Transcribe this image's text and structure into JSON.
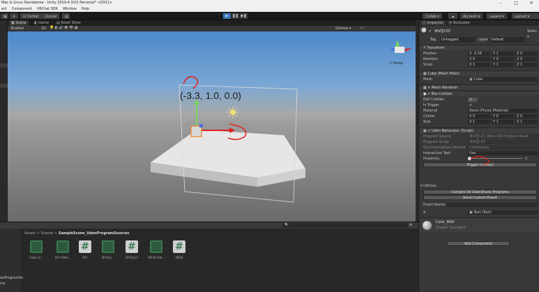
{
  "title": "Mac & Linux Standalone - Unity 2019.4.31f1 Personal* <DX11>",
  "window_controls": {
    "minimize": "–",
    "maximize": "□",
    "close": "✕"
  },
  "menu": [
    "ect",
    "Component",
    "VRChat SDK",
    "Window",
    "Help"
  ],
  "toolbar": {
    "center": "Center",
    "local": "Local",
    "collab": "Collab ▾",
    "account": "Account ▾",
    "layers": "Layers ▾",
    "layout": "Layout ▾"
  },
  "scene_tabs": {
    "scene": "Scene",
    "game": "Game",
    "asset_store": "Asset Store"
  },
  "scene_toolbar": {
    "shading": "Shaded",
    "mode": "2D",
    "gizmos": "Gizmos ▾",
    "search": "All"
  },
  "scene": {
    "coord_label": "(-3.3, 1.0, 0.0)",
    "persp": "< Persp"
  },
  "project": {
    "breadcrumb": [
      "Assets",
      "Scenes",
      "SampleScene_UdonProgramSources"
    ],
    "assets": [
      {
        "name": "Cube (U..."
      },
      {
        "name": "큐브 Udon..."
      },
      {
        "name": "큐브"
      },
      {
        "name": "큐브입니..."
      },
      {
        "name": "큐브입니다"
      },
      {
        "name": "버튼용 Udo..."
      },
      {
        "name": "버튼용"
      }
    ],
    "left_fragments": [
      "onProgramSc",
      "ms"
    ]
  },
  "inspector": {
    "tabs": {
      "inspector": "Inspector",
      "occlusion": "Occlusion"
    },
    "object_name": "큐브입니다",
    "static": "Static ▾",
    "tag_label": "Tag",
    "tag_value": "Untagged",
    "layer_label": "Layer",
    "layer_value": "Default",
    "transform": {
      "title": "Transform",
      "position": {
        "label": "Position",
        "x": "-3.34",
        "y": "1",
        "z": "0"
      },
      "rotation": {
        "label": "Rotation",
        "x": "0",
        "y": "0",
        "z": "0"
      },
      "scale": {
        "label": "Scale",
        "x": "1",
        "y": "1",
        "z": "1"
      }
    },
    "mesh_filter": {
      "title": "Cube (Mesh Filter)",
      "mesh_label": "Mesh",
      "mesh_value": "Cube"
    },
    "mesh_renderer": {
      "title": "Mesh Renderer"
    },
    "box_collider": {
      "title": "Box Collider",
      "edit_collider": "Edit Collider",
      "is_trigger": "Is Trigger",
      "material_label": "Material",
      "material_value": "None (Physic Material)",
      "center": {
        "label": "Center",
        "x": "0",
        "y": "0",
        "z": "0"
      },
      "size": {
        "label": "Size",
        "x": "1",
        "y": "1",
        "z": "1"
      }
    },
    "udon": {
      "title": "Udon Behaviour (Script)",
      "program_source_label": "Program Source",
      "program_source_value": "큐브입니다 Udon C# Program Asset",
      "program_script_label": "Program Script",
      "program_script_value": "큐브입니다",
      "sync_label": "Synchronization Method",
      "sync_value": "Continuous",
      "interaction_text_label": "Interaction Text",
      "interaction_text_value": "Use",
      "proximity_label": "Proximity",
      "proximity_value": "2",
      "proximity_fraction": 0.0,
      "trigger_button": "Trigger Interact"
    },
    "utilities": {
      "title": "Utilities",
      "compile_button": "Compile All UdonSharp Programs",
      "send_event_button": "Send Custom Event",
      "event_name_label": "Event Name:",
      "a_label": "A",
      "a_value": "Text (Text)"
    },
    "material": {
      "name": "Color_M00",
      "shader_label": "Shader",
      "shader_value": "Standard"
    },
    "add_component": "Add Component"
  },
  "colors": {
    "accent": "#3a79bb",
    "udon_green": "#3a7a52",
    "annotation_red": "#e02020"
  }
}
